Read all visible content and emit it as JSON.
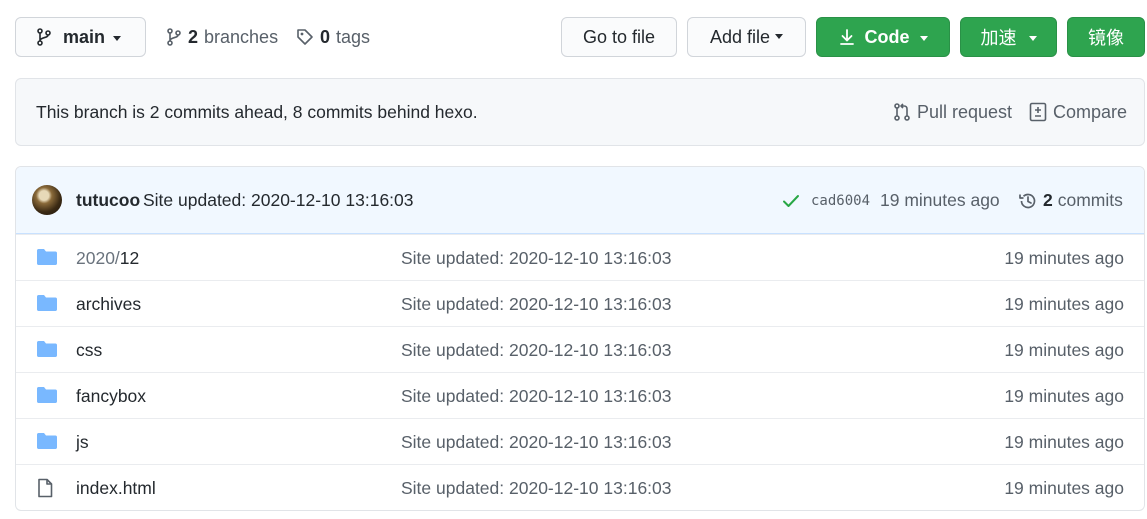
{
  "topbar": {
    "branch": "main",
    "branches_count": "2",
    "branches_label": "branches",
    "tags_count": "0",
    "tags_label": "tags",
    "go_to_file": "Go to file",
    "add_file": "Add file",
    "code": "Code",
    "speedup": "加速",
    "mirror": "镜像"
  },
  "flash": {
    "message": "This branch is 2 commits ahead, 8 commits behind hexo.",
    "pull_request": "Pull request",
    "compare": "Compare"
  },
  "commit": {
    "author": "tutucoo",
    "message": "Site updated: 2020-12-10 13:16:03",
    "sha": "cad6004",
    "age": "19 minutes ago",
    "commits_count": "2",
    "commits_label": "commits"
  },
  "files": [
    {
      "type": "folder",
      "name_prefix": "2020/",
      "name": "12",
      "message": "Site updated: 2020-12-10 13:16:03",
      "age": "19 minutes ago"
    },
    {
      "type": "folder",
      "name_prefix": "",
      "name": "archives",
      "message": "Site updated: 2020-12-10 13:16:03",
      "age": "19 minutes ago"
    },
    {
      "type": "folder",
      "name_prefix": "",
      "name": "css",
      "message": "Site updated: 2020-12-10 13:16:03",
      "age": "19 minutes ago"
    },
    {
      "type": "folder",
      "name_prefix": "",
      "name": "fancybox",
      "message": "Site updated: 2020-12-10 13:16:03",
      "age": "19 minutes ago"
    },
    {
      "type": "folder",
      "name_prefix": "",
      "name": "js",
      "message": "Site updated: 2020-12-10 13:16:03",
      "age": "19 minutes ago"
    },
    {
      "type": "file",
      "name_prefix": "",
      "name": "index.html",
      "message": "Site updated: 2020-12-10 13:16:03",
      "age": "19 minutes ago"
    }
  ],
  "colors": {
    "green": "#2ea44f",
    "folder_blue": "#79b8ff",
    "check_green": "#28a745"
  }
}
